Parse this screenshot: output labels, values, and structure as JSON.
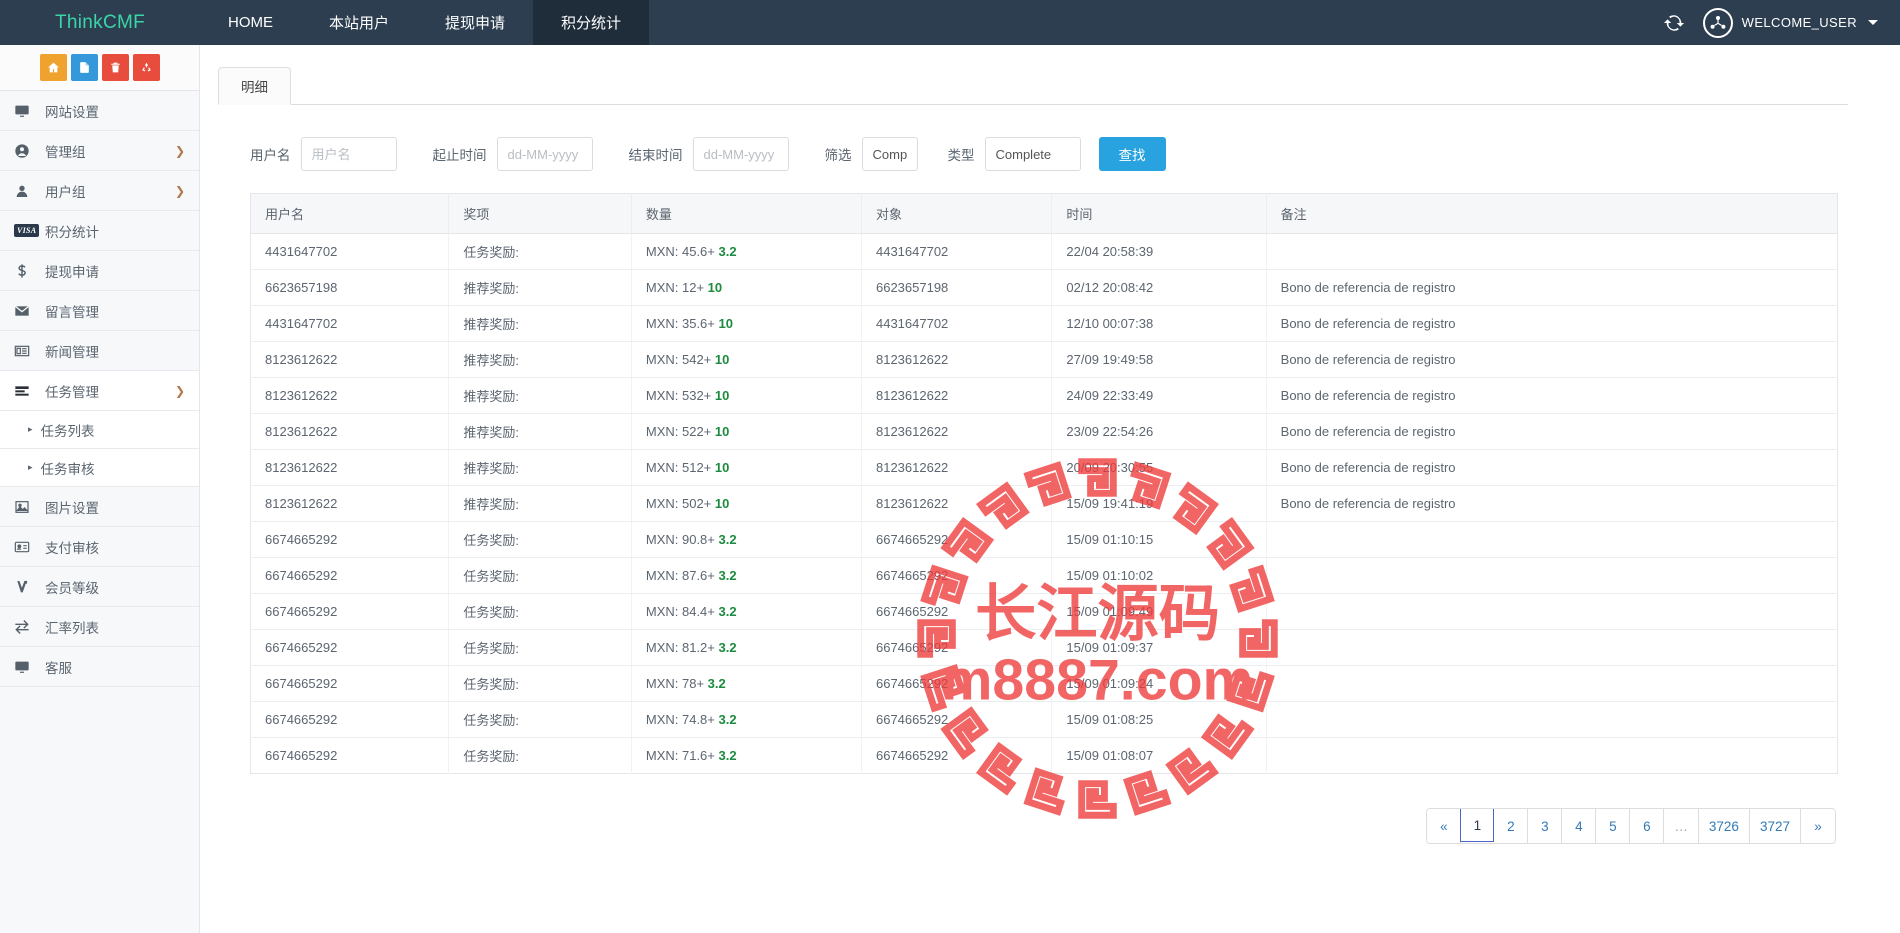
{
  "navbar": {
    "brand": "ThinkCMF",
    "links": [
      {
        "label": "HOME",
        "active": false
      },
      {
        "label": "本站用户",
        "active": false
      },
      {
        "label": "提现申请",
        "active": false
      },
      {
        "label": "积分统计",
        "active": true
      }
    ],
    "refresh_icon": "refresh-icon",
    "avatar_icon": "share-nodes-icon",
    "user_label": "WELCOME_USER"
  },
  "sidebar": {
    "quick_actions": [
      {
        "name": "home-icon",
        "color": "#f0a22e"
      },
      {
        "name": "file-icon",
        "color": "#3498db"
      },
      {
        "name": "trash-icon",
        "color": "#e74c3c"
      },
      {
        "name": "recycle-icon",
        "color": "#e74c3c"
      }
    ],
    "items": [
      {
        "label": "网站设置",
        "icon": "monitor-icon",
        "arrow": false,
        "sub": false
      },
      {
        "label": "管理组",
        "icon": "user-circle-icon",
        "arrow": true,
        "sub": false
      },
      {
        "label": "用户组",
        "icon": "user-icon",
        "arrow": true,
        "sub": false
      },
      {
        "label": "积分统计",
        "icon": "visa-icon",
        "arrow": false,
        "sub": false
      },
      {
        "label": "提现申请",
        "icon": "dollar-icon",
        "arrow": false,
        "sub": false
      },
      {
        "label": "留言管理",
        "icon": "envelope-icon",
        "arrow": false,
        "sub": false
      },
      {
        "label": "新闻管理",
        "icon": "newspaper-icon",
        "arrow": false,
        "sub": false
      },
      {
        "label": "任务管理",
        "icon": "list-icon",
        "arrow": true,
        "sub": false
      },
      {
        "label": "任务列表",
        "icon": "bullet-icon",
        "arrow": false,
        "sub": true
      },
      {
        "label": "任务审核",
        "icon": "bullet-icon",
        "arrow": false,
        "sub": true
      },
      {
        "label": "图片设置",
        "icon": "image-icon",
        "arrow": false,
        "sub": false
      },
      {
        "label": "支付审核",
        "icon": "id-card-icon",
        "arrow": false,
        "sub": false
      },
      {
        "label": "会员等级",
        "icon": "vine-icon",
        "arrow": false,
        "sub": false
      },
      {
        "label": "汇率列表",
        "icon": "exchange-icon",
        "arrow": false,
        "sub": false
      },
      {
        "label": "客服",
        "icon": "monitor-icon",
        "arrow": false,
        "sub": false
      }
    ]
  },
  "tabs": [
    {
      "label": "明细",
      "active": true
    }
  ],
  "filters": {
    "username_label": "用户名",
    "username_value": "",
    "username_placeholder": "用户名",
    "start_label": "起止时间",
    "start_value": "",
    "start_placeholder": "dd-MM-yyyy",
    "end_label": "结束时间",
    "end_value": "",
    "end_placeholder": "dd-MM-yyyy",
    "filter_label": "筛选",
    "filter_value": "Comple",
    "type_label": "类型",
    "type_value": "Complete",
    "search_button": "查找"
  },
  "table": {
    "headers": [
      "用户名",
      "奖项",
      "数量",
      "对象",
      "时间",
      "备注"
    ],
    "rows": [
      {
        "user": "4431647702",
        "prize": "任务奖励:",
        "amount_base": "MXN: 45.6+",
        "amount_bonus": "3.2",
        "target": "4431647702",
        "time": "22/04 20:58:39",
        "remark": ""
      },
      {
        "user": "6623657198",
        "prize": "推荐奖励:",
        "amount_base": "MXN: 12+",
        "amount_bonus": "10",
        "target": "6623657198",
        "time": "02/12 20:08:42",
        "remark": "Bono de referencia de registro"
      },
      {
        "user": "4431647702",
        "prize": "推荐奖励:",
        "amount_base": "MXN: 35.6+",
        "amount_bonus": "10",
        "target": "4431647702",
        "time": "12/10 00:07:38",
        "remark": "Bono de referencia de registro"
      },
      {
        "user": "8123612622",
        "prize": "推荐奖励:",
        "amount_base": "MXN: 542+",
        "amount_bonus": "10",
        "target": "8123612622",
        "time": "27/09 19:49:58",
        "remark": "Bono de referencia de registro"
      },
      {
        "user": "8123612622",
        "prize": "推荐奖励:",
        "amount_base": "MXN: 532+",
        "amount_bonus": "10",
        "target": "8123612622",
        "time": "24/09 22:33:49",
        "remark": "Bono de referencia de registro"
      },
      {
        "user": "8123612622",
        "prize": "推荐奖励:",
        "amount_base": "MXN: 522+",
        "amount_bonus": "10",
        "target": "8123612622",
        "time": "23/09 22:54:26",
        "remark": "Bono de referencia de registro"
      },
      {
        "user": "8123612622",
        "prize": "推荐奖励:",
        "amount_base": "MXN: 512+",
        "amount_bonus": "10",
        "target": "8123612622",
        "time": "20/09 20:30:55",
        "remark": "Bono de referencia de registro"
      },
      {
        "user": "8123612622",
        "prize": "推荐奖励:",
        "amount_base": "MXN: 502+",
        "amount_bonus": "10",
        "target": "8123612622",
        "time": "15/09 19:41:19",
        "remark": "Bono de referencia de registro"
      },
      {
        "user": "6674665292",
        "prize": "任务奖励:",
        "amount_base": "MXN: 90.8+",
        "amount_bonus": "3.2",
        "target": "6674665292",
        "time": "15/09 01:10:15",
        "remark": ""
      },
      {
        "user": "6674665292",
        "prize": "任务奖励:",
        "amount_base": "MXN: 87.6+",
        "amount_bonus": "3.2",
        "target": "6674665292",
        "time": "15/09 01:10:02",
        "remark": ""
      },
      {
        "user": "6674665292",
        "prize": "任务奖励:",
        "amount_base": "MXN: 84.4+",
        "amount_bonus": "3.2",
        "target": "6674665292",
        "time": "15/09 01:09:49",
        "remark": ""
      },
      {
        "user": "6674665292",
        "prize": "任务奖励:",
        "amount_base": "MXN: 81.2+",
        "amount_bonus": "3.2",
        "target": "6674665292",
        "time": "15/09 01:09:37",
        "remark": ""
      },
      {
        "user": "6674665292",
        "prize": "任务奖励:",
        "amount_base": "MXN: 78+",
        "amount_bonus": "3.2",
        "target": "6674665292",
        "time": "15/09 01:09:24",
        "remark": ""
      },
      {
        "user": "6674665292",
        "prize": "任务奖励:",
        "amount_base": "MXN: 74.8+",
        "amount_bonus": "3.2",
        "target": "6674665292",
        "time": "15/09 01:08:25",
        "remark": ""
      },
      {
        "user": "6674665292",
        "prize": "任务奖励:",
        "amount_base": "MXN: 71.6+",
        "amount_bonus": "3.2",
        "target": "6674665292",
        "time": "15/09 01:08:07",
        "remark": ""
      }
    ]
  },
  "pagination": {
    "prev": "«",
    "next": "»",
    "pages": [
      "1",
      "2",
      "3",
      "4",
      "5",
      "6",
      "…",
      "3726",
      "3727"
    ],
    "current": "1"
  },
  "watermark": {
    "line1": "长江源码",
    "line2": "m8887.com",
    "color": "#ef3b3b"
  },
  "colors": {
    "navbar_bg": "#2c3e50",
    "brand": "#3ad6a8",
    "accent": "#28a3df",
    "amount_green": "#1d8b3f",
    "page_link": "#337ab7"
  }
}
